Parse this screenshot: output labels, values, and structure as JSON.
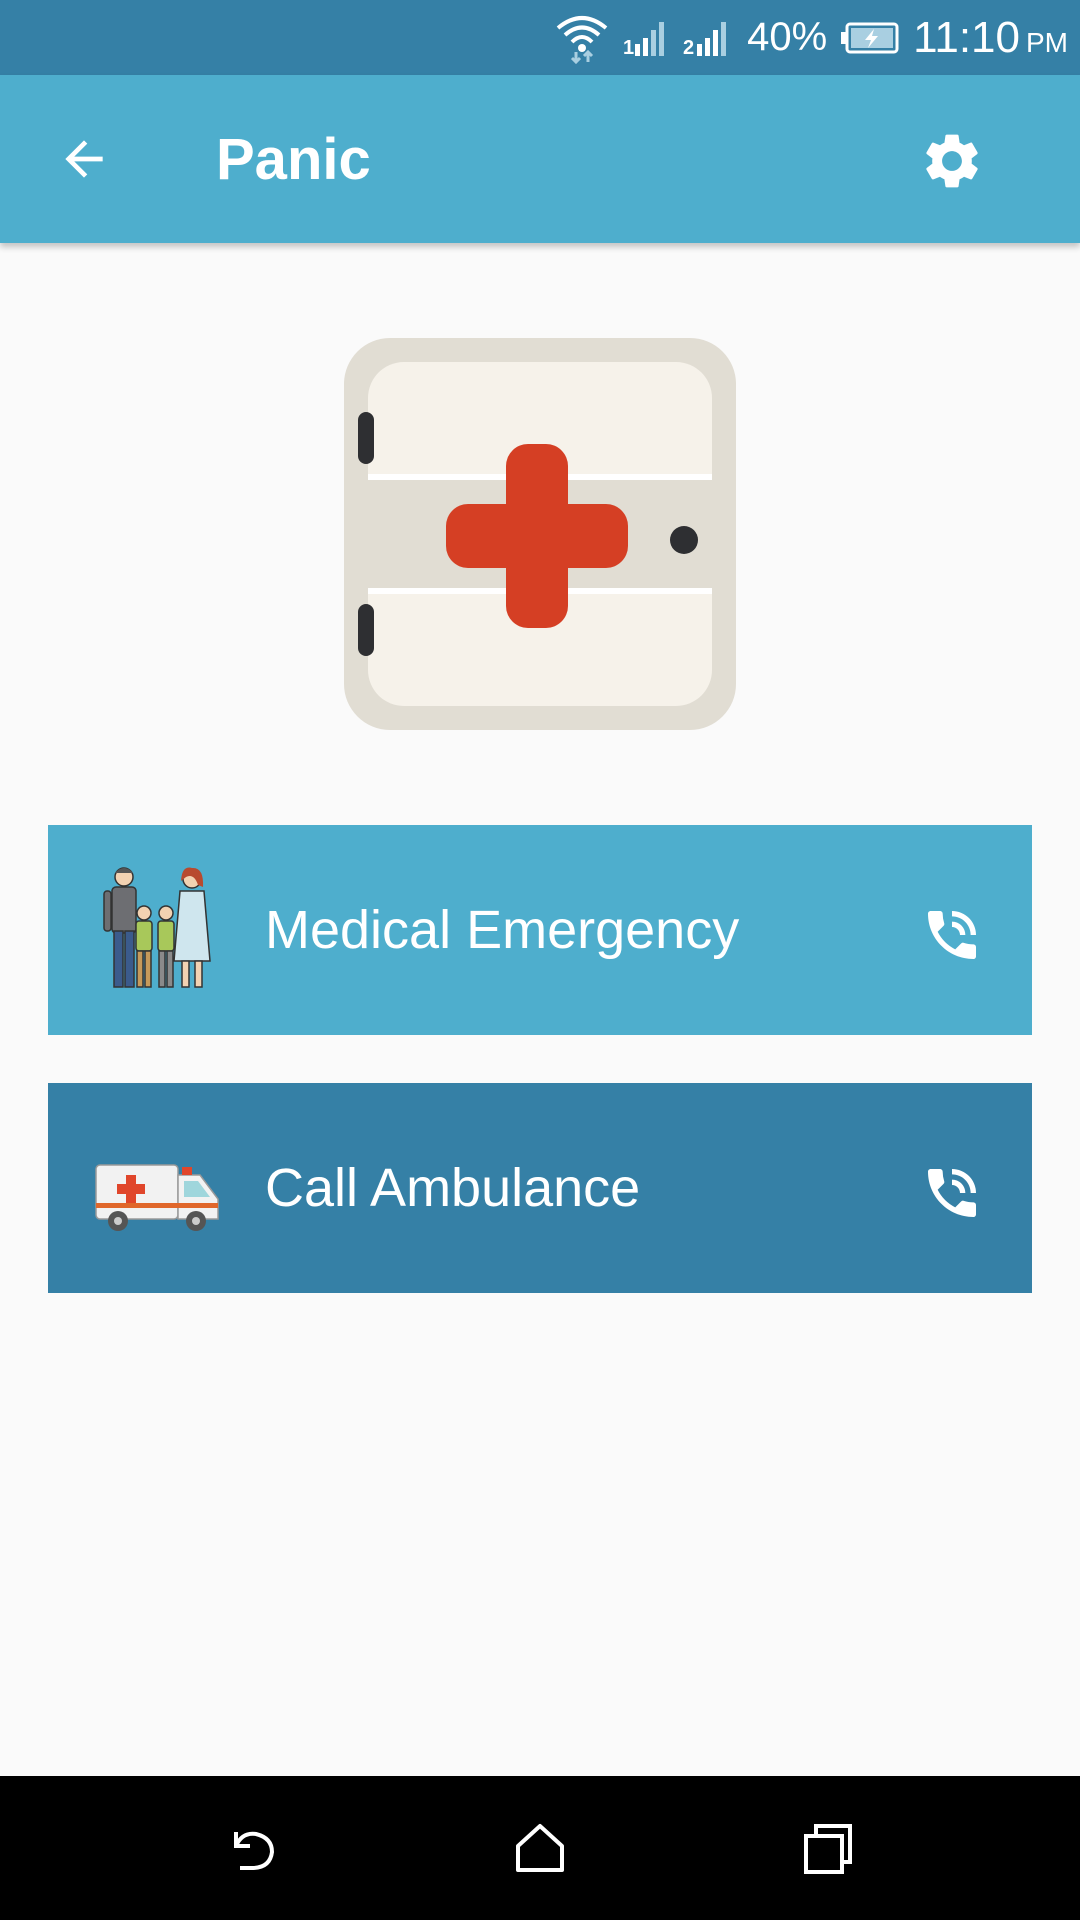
{
  "status_bar": {
    "battery_percent": "40%",
    "time": "11:10",
    "ampm": "PM",
    "icons": [
      "wifi-icon",
      "signal-1-icon",
      "signal-2-icon",
      "battery-charging-icon"
    ]
  },
  "app_bar": {
    "title": "Panic",
    "back_icon": "arrow-left-icon",
    "settings_icon": "gear-icon"
  },
  "hero": {
    "icon": "first-aid-kit-icon"
  },
  "actions": [
    {
      "label": "Medical Emergency",
      "icon": "family-illustration",
      "trailing_icon": "phone-call-icon",
      "color": "#4eaecd"
    },
    {
      "label": "Call Ambulance",
      "icon": "ambulance-illustration",
      "trailing_icon": "phone-call-icon",
      "color": "#3580a6"
    }
  ],
  "nav_bar": {
    "buttons": [
      "back-nav-icon",
      "home-nav-icon",
      "recents-nav-icon"
    ]
  },
  "colors": {
    "status_bar": "#3580a6",
    "app_bar": "#4eaecd",
    "background": "#fafafa",
    "cross_red": "#d53f24"
  }
}
